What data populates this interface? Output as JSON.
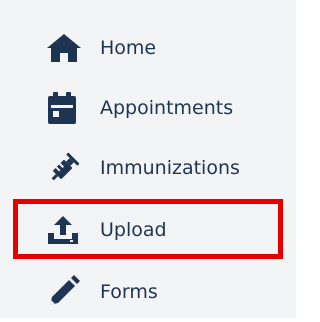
{
  "nav": {
    "items": [
      {
        "label": "Home",
        "icon": "home-icon"
      },
      {
        "label": "Appointments",
        "icon": "calendar-icon"
      },
      {
        "label": "Immunizations",
        "icon": "syringe-icon"
      },
      {
        "label": "Upload",
        "icon": "upload-icon"
      },
      {
        "label": "Forms",
        "icon": "pencil-icon"
      }
    ],
    "highlighted_item": "Upload"
  },
  "colors": {
    "sidebar_background": "#f3f4f6",
    "icon": "#1d3452",
    "text": "#1d3452",
    "highlight_border": "#e50000"
  }
}
